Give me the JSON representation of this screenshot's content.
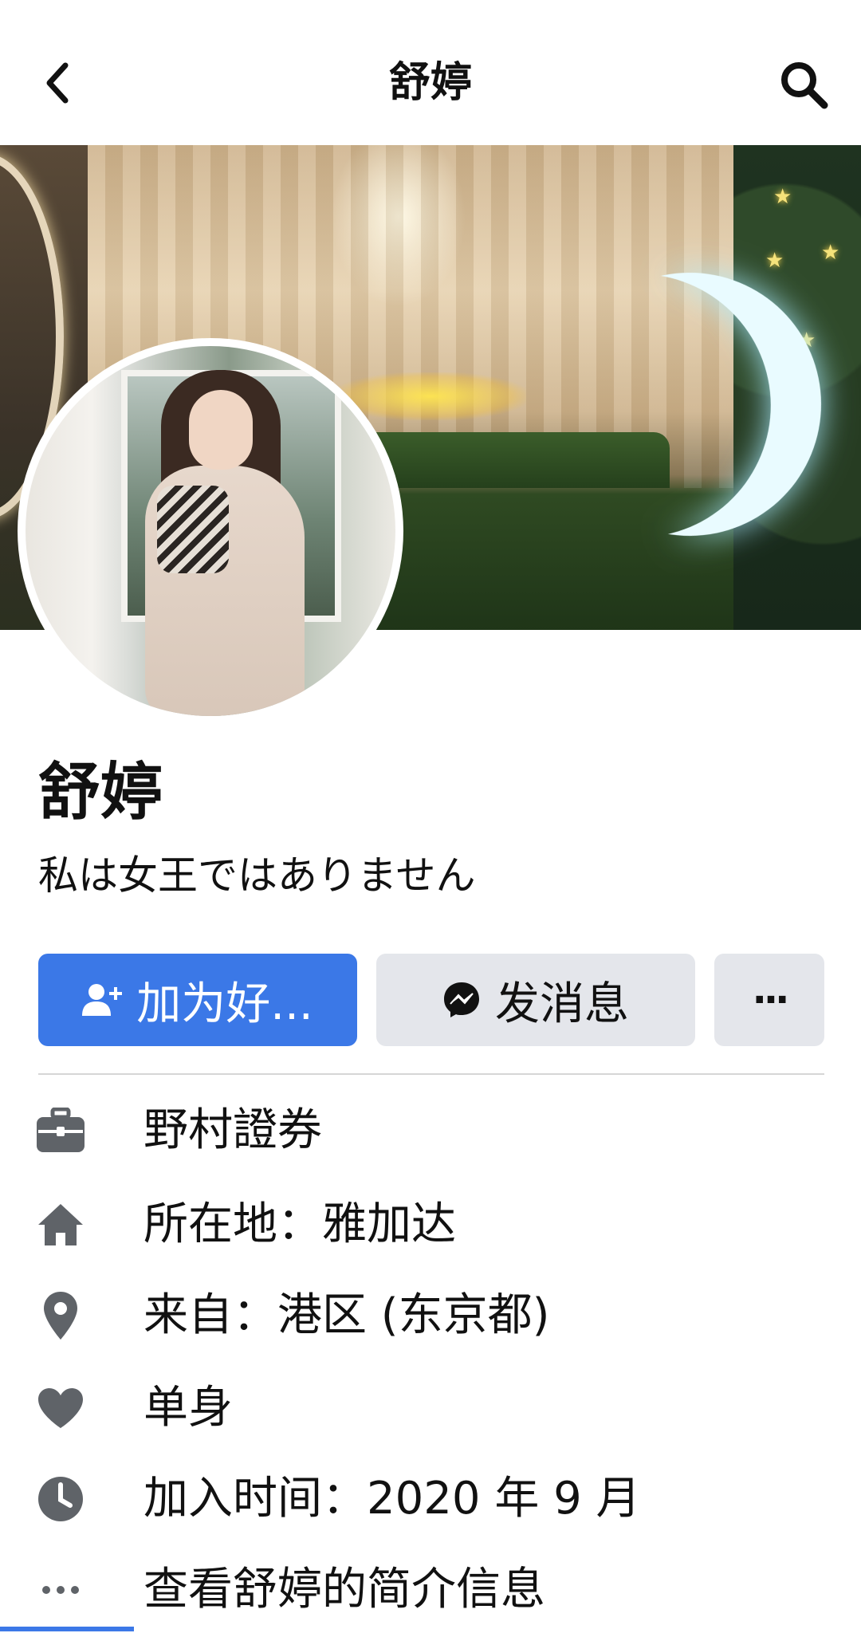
{
  "nav": {
    "back_icon": "chevron-left-icon",
    "title": "舒婷",
    "search_icon": "search-icon"
  },
  "cover": {
    "description_icon": "cover-photo"
  },
  "profile": {
    "name": "舒婷",
    "bio": "私は女王ではありません"
  },
  "actions": {
    "add_friend_label": "加为好...",
    "add_friend_icon": "add-person-icon",
    "message_label": "发消息",
    "message_icon": "messenger-icon",
    "more_label": "···",
    "accent_color": "#3b78e7",
    "secondary_color": "#e4e6eb"
  },
  "details": [
    {
      "icon": "briefcase-icon",
      "text": "野村證券"
    },
    {
      "icon": "home-icon",
      "text": "所在地：雅加达"
    },
    {
      "icon": "location-pin-icon",
      "text": "来自：港区 (东京都)"
    },
    {
      "icon": "heart-icon",
      "text": "单身"
    },
    {
      "icon": "clock-icon",
      "text": "加入时间：2020 年 9 月"
    },
    {
      "icon": "more-dots-icon",
      "text": "查看舒婷的简介信息"
    }
  ]
}
